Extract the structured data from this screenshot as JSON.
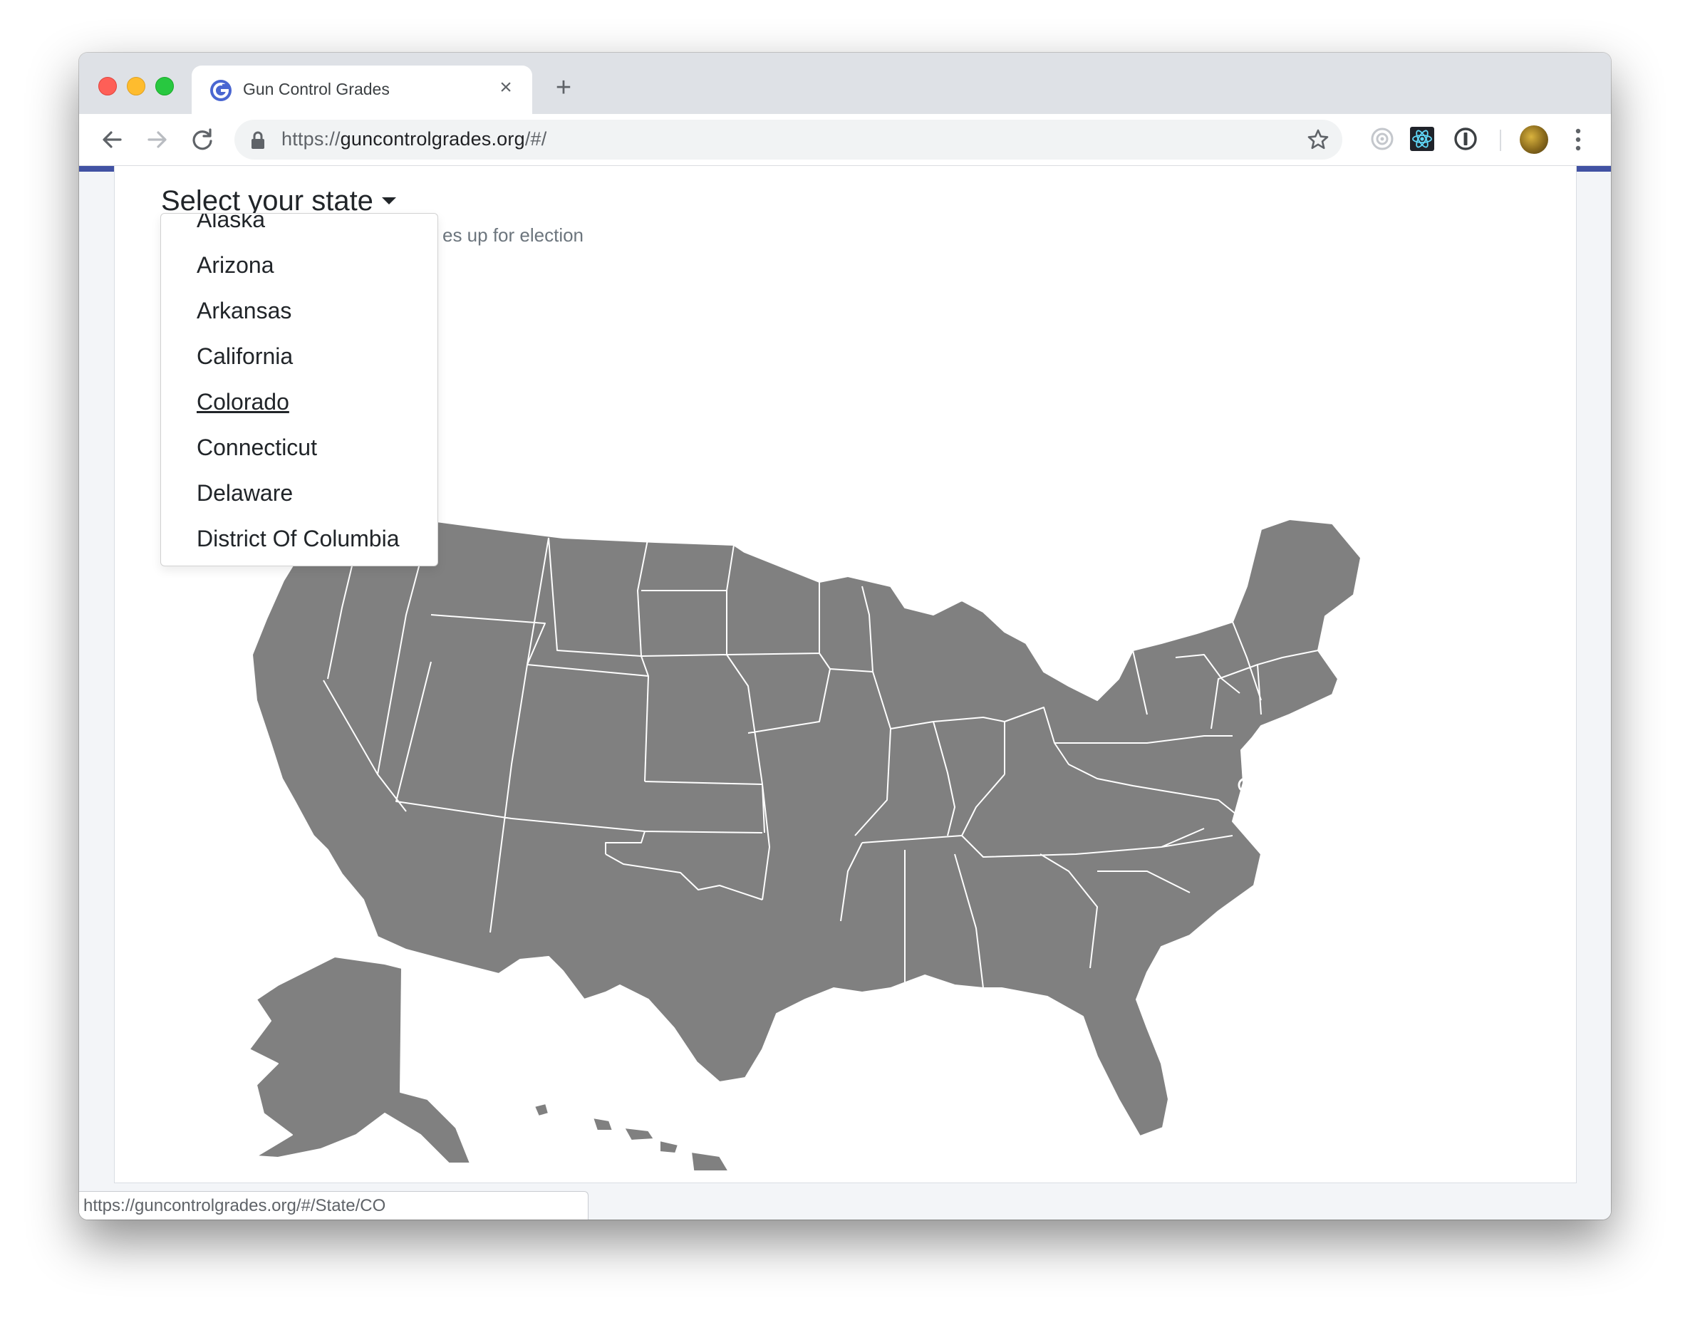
{
  "browser": {
    "tab_title": "Gun Control Grades",
    "tab_favicon_letter": "G",
    "url_scheme": "https://",
    "url_host": "guncontrolgrades.org",
    "url_path": "/#/",
    "status_url": "https://guncontrolgrades.org/#/State/CO"
  },
  "page": {
    "heading": "Select your state",
    "subtitle_visible": "es up for election"
  },
  "dropdown": {
    "items": [
      {
        "label": "Alaska"
      },
      {
        "label": "Arizona"
      },
      {
        "label": "Arkansas"
      },
      {
        "label": "California"
      },
      {
        "label": "Colorado",
        "hovered": true
      },
      {
        "label": "Connecticut"
      },
      {
        "label": "Delaware"
      },
      {
        "label": "District Of Columbia"
      }
    ]
  },
  "map": {
    "kind": "us-states",
    "state_fill": "#808080",
    "border_color": "#ffffff"
  },
  "colors": {
    "accent_stripe": "#4152a3",
    "favicon": "#4a66d1"
  }
}
